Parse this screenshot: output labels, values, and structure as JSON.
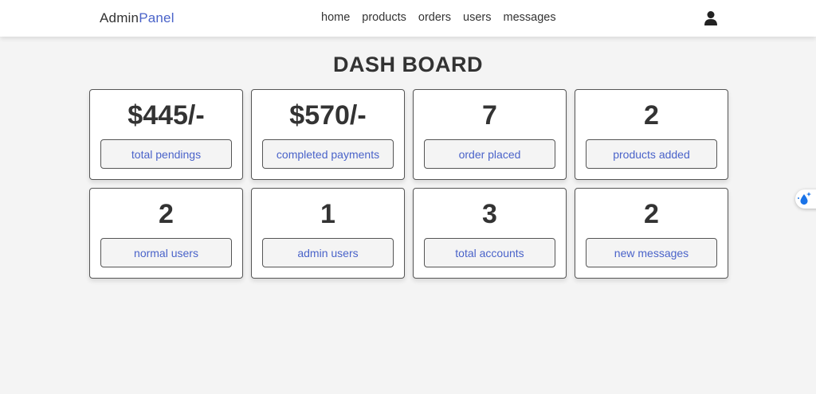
{
  "header": {
    "logo_prefix": "Admin",
    "logo_accent": "Panel",
    "nav": [
      "home",
      "products",
      "orders",
      "users",
      "messages"
    ],
    "user_icon": "user-icon"
  },
  "page_title": "DASH BOARD",
  "cards": [
    {
      "value": "$445/-",
      "label": "total pendings"
    },
    {
      "value": "$570/-",
      "label": "completed payments"
    },
    {
      "value": "7",
      "label": "order placed"
    },
    {
      "value": "2",
      "label": "products added"
    },
    {
      "value": "2",
      "label": "normal users"
    },
    {
      "value": "1",
      "label": "admin users"
    },
    {
      "value": "3",
      "label": "total accounts"
    },
    {
      "value": "2",
      "label": "new messages"
    }
  ],
  "colors": {
    "accent": "#4a63c9",
    "text": "#333333",
    "background": "#f4f4f4",
    "widget_icon": "#1a73e8"
  },
  "widget": {
    "icon": "sparkle-droplet-icon"
  }
}
